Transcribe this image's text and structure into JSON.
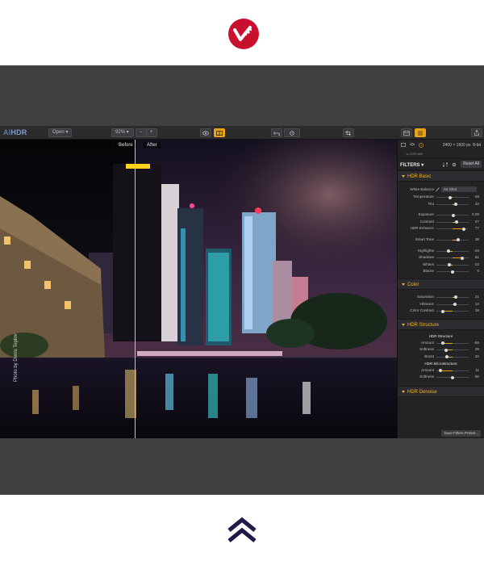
{
  "app": {
    "brand_prefix": "AI",
    "brand_name": "HDR",
    "open_label": "Open",
    "zoom_label": "92%",
    "zoom_out": "−",
    "zoom_in": "+"
  },
  "viewer": {
    "before_label": "Before",
    "after_label": "After",
    "credit": "Photo by Denis Teplov",
    "split_fraction": 0.34
  },
  "panel": {
    "dimensions": "2400 × 1600 px",
    "bit_depth": "8-bit",
    "sub": "1x DSP-8bit",
    "filters_label": "FILTERS",
    "reset_label": "Reset All",
    "save_label": "Save Filters Preset...",
    "sections": {
      "hdr_basic": "HDR Basic",
      "color": "Color",
      "hdr_structure": "HDR Structure",
      "hdr_denoise": "HDR Denoise"
    },
    "white_balance": {
      "label": "White Balance",
      "value": "As Shot"
    },
    "basic_rows": [
      {
        "label": "Temperature",
        "value": "-48",
        "pos": 0.42
      },
      {
        "label": "Tint",
        "value": "23",
        "pos": 0.6
      },
      {
        "label": "Exposure",
        "value": "0.09",
        "pos": 0.52
      },
      {
        "label": "Contrast",
        "value": "27",
        "pos": 0.62
      },
      {
        "label": "HDR Enhance",
        "value": "77",
        "pos": 0.85
      },
      {
        "label": "Smart Tone",
        "value": "38",
        "pos": 0.68
      },
      {
        "label": "Highlights",
        "value": "-25",
        "pos": 0.38
      },
      {
        "label": "Shadows",
        "value": "61",
        "pos": 0.8
      },
      {
        "label": "Whites",
        "value": "-23",
        "pos": 0.4
      },
      {
        "label": "Blacks",
        "value": "0",
        "pos": 0.5
      }
    ],
    "color_rows": [
      {
        "label": "Saturation",
        "value": "21",
        "pos": 0.6
      },
      {
        "label": "Vibrance",
        "value": "14",
        "pos": 0.57
      },
      {
        "label": "Color Contrast",
        "value": "19",
        "pos": 0.2
      }
    ],
    "structure_sub1": "HDR Structure",
    "structure_rows1": [
      {
        "label": "Amount",
        "value": "-65",
        "pos": 0.2
      },
      {
        "label": "Softness",
        "value": "29",
        "pos": 0.3
      },
      {
        "label": "Boost",
        "value": "32",
        "pos": 0.32
      }
    ],
    "structure_sub2": "HDR Microstructure",
    "structure_rows2": [
      {
        "label": "Amount",
        "value": "11",
        "pos": 0.12
      },
      {
        "label": "Softness",
        "value": "50",
        "pos": 0.5
      }
    ]
  },
  "colors": {
    "accent": "#e8a316",
    "logo_red": "#c8102e",
    "section_title": "#f0b429",
    "bottom_icon": "#1d1a4a"
  }
}
